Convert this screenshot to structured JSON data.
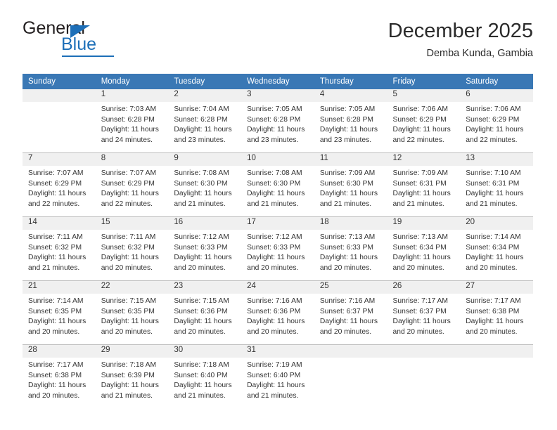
{
  "brand": {
    "name_top": "General",
    "name_bottom": "Blue",
    "accent_color": "#1d6fb8",
    "triangle_icon": "triangle-icon"
  },
  "header": {
    "title": "December 2025",
    "subtitle": "Demba Kunda, Gambia"
  },
  "theme": {
    "header_row_bg": "#3a78b5",
    "header_row_text": "#ffffff",
    "daynum_band_bg": "#f0f0f0",
    "cell_bg": "#ffffff",
    "separator": "#bfbfbf",
    "text": "#333333"
  },
  "weekday_headers": [
    "Sunday",
    "Monday",
    "Tuesday",
    "Wednesday",
    "Thursday",
    "Friday",
    "Saturday"
  ],
  "labels": {
    "sunrise_prefix": "Sunrise:",
    "sunset_prefix": "Sunset:",
    "daylight_prefix": "Daylight:"
  },
  "weeks": [
    [
      {
        "day": "",
        "empty": true,
        "lines": []
      },
      {
        "day": "1",
        "lines": [
          "Sunrise: 7:03 AM",
          "Sunset: 6:28 PM",
          "Daylight: 11 hours",
          "and 24 minutes."
        ]
      },
      {
        "day": "2",
        "lines": [
          "Sunrise: 7:04 AM",
          "Sunset: 6:28 PM",
          "Daylight: 11 hours",
          "and 23 minutes."
        ]
      },
      {
        "day": "3",
        "lines": [
          "Sunrise: 7:05 AM",
          "Sunset: 6:28 PM",
          "Daylight: 11 hours",
          "and 23 minutes."
        ]
      },
      {
        "day": "4",
        "lines": [
          "Sunrise: 7:05 AM",
          "Sunset: 6:28 PM",
          "Daylight: 11 hours",
          "and 23 minutes."
        ]
      },
      {
        "day": "5",
        "lines": [
          "Sunrise: 7:06 AM",
          "Sunset: 6:29 PM",
          "Daylight: 11 hours",
          "and 22 minutes."
        ]
      },
      {
        "day": "6",
        "lines": [
          "Sunrise: 7:06 AM",
          "Sunset: 6:29 PM",
          "Daylight: 11 hours",
          "and 22 minutes."
        ]
      }
    ],
    [
      {
        "day": "7",
        "lines": [
          "Sunrise: 7:07 AM",
          "Sunset: 6:29 PM",
          "Daylight: 11 hours",
          "and 22 minutes."
        ]
      },
      {
        "day": "8",
        "lines": [
          "Sunrise: 7:07 AM",
          "Sunset: 6:29 PM",
          "Daylight: 11 hours",
          "and 22 minutes."
        ]
      },
      {
        "day": "9",
        "lines": [
          "Sunrise: 7:08 AM",
          "Sunset: 6:30 PM",
          "Daylight: 11 hours",
          "and 21 minutes."
        ]
      },
      {
        "day": "10",
        "lines": [
          "Sunrise: 7:08 AM",
          "Sunset: 6:30 PM",
          "Daylight: 11 hours",
          "and 21 minutes."
        ]
      },
      {
        "day": "11",
        "lines": [
          "Sunrise: 7:09 AM",
          "Sunset: 6:30 PM",
          "Daylight: 11 hours",
          "and 21 minutes."
        ]
      },
      {
        "day": "12",
        "lines": [
          "Sunrise: 7:09 AM",
          "Sunset: 6:31 PM",
          "Daylight: 11 hours",
          "and 21 minutes."
        ]
      },
      {
        "day": "13",
        "lines": [
          "Sunrise: 7:10 AM",
          "Sunset: 6:31 PM",
          "Daylight: 11 hours",
          "and 21 minutes."
        ]
      }
    ],
    [
      {
        "day": "14",
        "lines": [
          "Sunrise: 7:11 AM",
          "Sunset: 6:32 PM",
          "Daylight: 11 hours",
          "and 21 minutes."
        ]
      },
      {
        "day": "15",
        "lines": [
          "Sunrise: 7:11 AM",
          "Sunset: 6:32 PM",
          "Daylight: 11 hours",
          "and 20 minutes."
        ]
      },
      {
        "day": "16",
        "lines": [
          "Sunrise: 7:12 AM",
          "Sunset: 6:33 PM",
          "Daylight: 11 hours",
          "and 20 minutes."
        ]
      },
      {
        "day": "17",
        "lines": [
          "Sunrise: 7:12 AM",
          "Sunset: 6:33 PM",
          "Daylight: 11 hours",
          "and 20 minutes."
        ]
      },
      {
        "day": "18",
        "lines": [
          "Sunrise: 7:13 AM",
          "Sunset: 6:33 PM",
          "Daylight: 11 hours",
          "and 20 minutes."
        ]
      },
      {
        "day": "19",
        "lines": [
          "Sunrise: 7:13 AM",
          "Sunset: 6:34 PM",
          "Daylight: 11 hours",
          "and 20 minutes."
        ]
      },
      {
        "day": "20",
        "lines": [
          "Sunrise: 7:14 AM",
          "Sunset: 6:34 PM",
          "Daylight: 11 hours",
          "and 20 minutes."
        ]
      }
    ],
    [
      {
        "day": "21",
        "lines": [
          "Sunrise: 7:14 AM",
          "Sunset: 6:35 PM",
          "Daylight: 11 hours",
          "and 20 minutes."
        ]
      },
      {
        "day": "22",
        "lines": [
          "Sunrise: 7:15 AM",
          "Sunset: 6:35 PM",
          "Daylight: 11 hours",
          "and 20 minutes."
        ]
      },
      {
        "day": "23",
        "lines": [
          "Sunrise: 7:15 AM",
          "Sunset: 6:36 PM",
          "Daylight: 11 hours",
          "and 20 minutes."
        ]
      },
      {
        "day": "24",
        "lines": [
          "Sunrise: 7:16 AM",
          "Sunset: 6:36 PM",
          "Daylight: 11 hours",
          "and 20 minutes."
        ]
      },
      {
        "day": "25",
        "lines": [
          "Sunrise: 7:16 AM",
          "Sunset: 6:37 PM",
          "Daylight: 11 hours",
          "and 20 minutes."
        ]
      },
      {
        "day": "26",
        "lines": [
          "Sunrise: 7:17 AM",
          "Sunset: 6:37 PM",
          "Daylight: 11 hours",
          "and 20 minutes."
        ]
      },
      {
        "day": "27",
        "lines": [
          "Sunrise: 7:17 AM",
          "Sunset: 6:38 PM",
          "Daylight: 11 hours",
          "and 20 minutes."
        ]
      }
    ],
    [
      {
        "day": "28",
        "lines": [
          "Sunrise: 7:17 AM",
          "Sunset: 6:38 PM",
          "Daylight: 11 hours",
          "and 20 minutes."
        ]
      },
      {
        "day": "29",
        "lines": [
          "Sunrise: 7:18 AM",
          "Sunset: 6:39 PM",
          "Daylight: 11 hours",
          "and 21 minutes."
        ]
      },
      {
        "day": "30",
        "lines": [
          "Sunrise: 7:18 AM",
          "Sunset: 6:40 PM",
          "Daylight: 11 hours",
          "and 21 minutes."
        ]
      },
      {
        "day": "31",
        "lines": [
          "Sunrise: 7:19 AM",
          "Sunset: 6:40 PM",
          "Daylight: 11 hours",
          "and 21 minutes."
        ]
      },
      {
        "day": "",
        "empty": true,
        "lines": []
      },
      {
        "day": "",
        "empty": true,
        "lines": []
      },
      {
        "day": "",
        "empty": true,
        "lines": []
      }
    ]
  ]
}
